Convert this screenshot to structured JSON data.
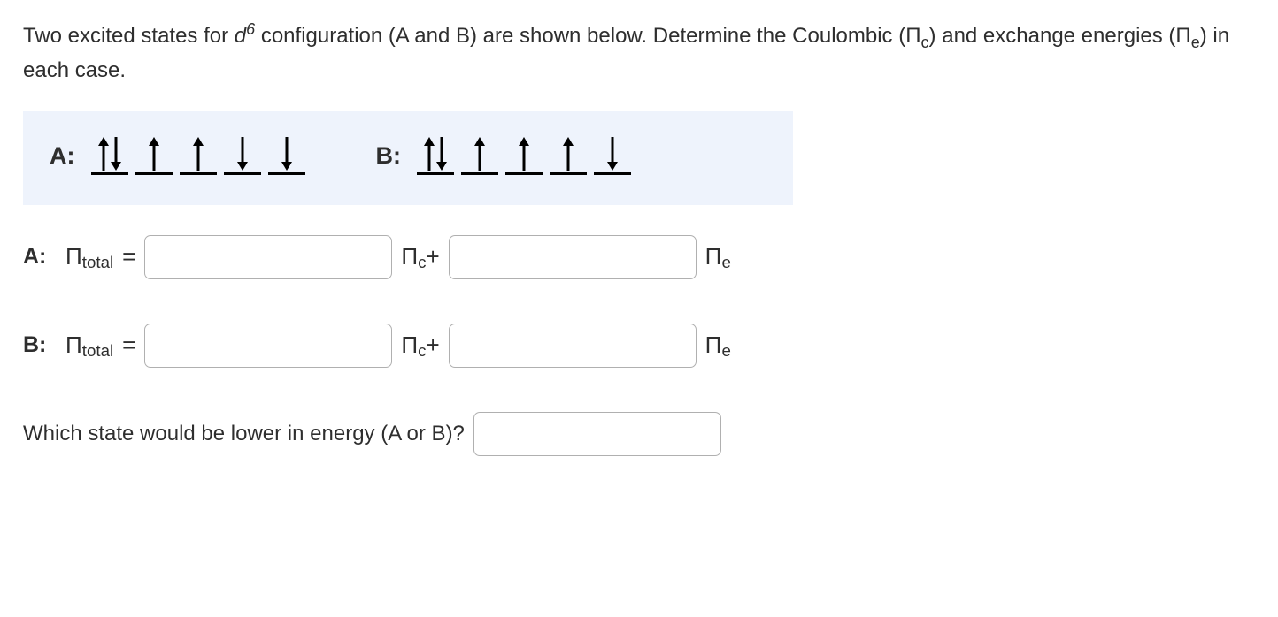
{
  "question": {
    "line1_pre": "Two excited states for ",
    "d": "d",
    "exp": "6",
    "line1_mid": " configuration (A and B) are shown below. Determine the Coulombic (Π",
    "pi_c_sub": "c",
    "line1_post": ")",
    "line2_pre": "and exchange energies (Π",
    "pi_e_sub": "e",
    "line2_post": ") in each case."
  },
  "diagram": {
    "labelA": "A:",
    "labelB": "B:",
    "configA": [
      [
        "up",
        "down"
      ],
      [
        "up"
      ],
      [
        "up"
      ],
      [
        "down"
      ],
      [
        "down"
      ]
    ],
    "configB": [
      [
        "up",
        "down"
      ],
      [
        "up"
      ],
      [
        "up"
      ],
      [
        "up"
      ],
      [
        "down"
      ]
    ]
  },
  "rows": {
    "A": {
      "prefix": "A:",
      "pi_total": "Π",
      "total_sub": "total",
      "eq": "=",
      "pi_c": "Π",
      "c_sub": "c",
      "plus": "+",
      "pi_e": "Π",
      "e_sub": "e"
    },
    "B": {
      "prefix": "B:",
      "pi_total": "Π",
      "total_sub": "total",
      "eq": "=",
      "pi_c": "Π",
      "c_sub": "c",
      "plus": "+",
      "pi_e": "Π",
      "e_sub": "e"
    }
  },
  "final": {
    "text": "Which state would be lower in energy (A or B)?"
  }
}
